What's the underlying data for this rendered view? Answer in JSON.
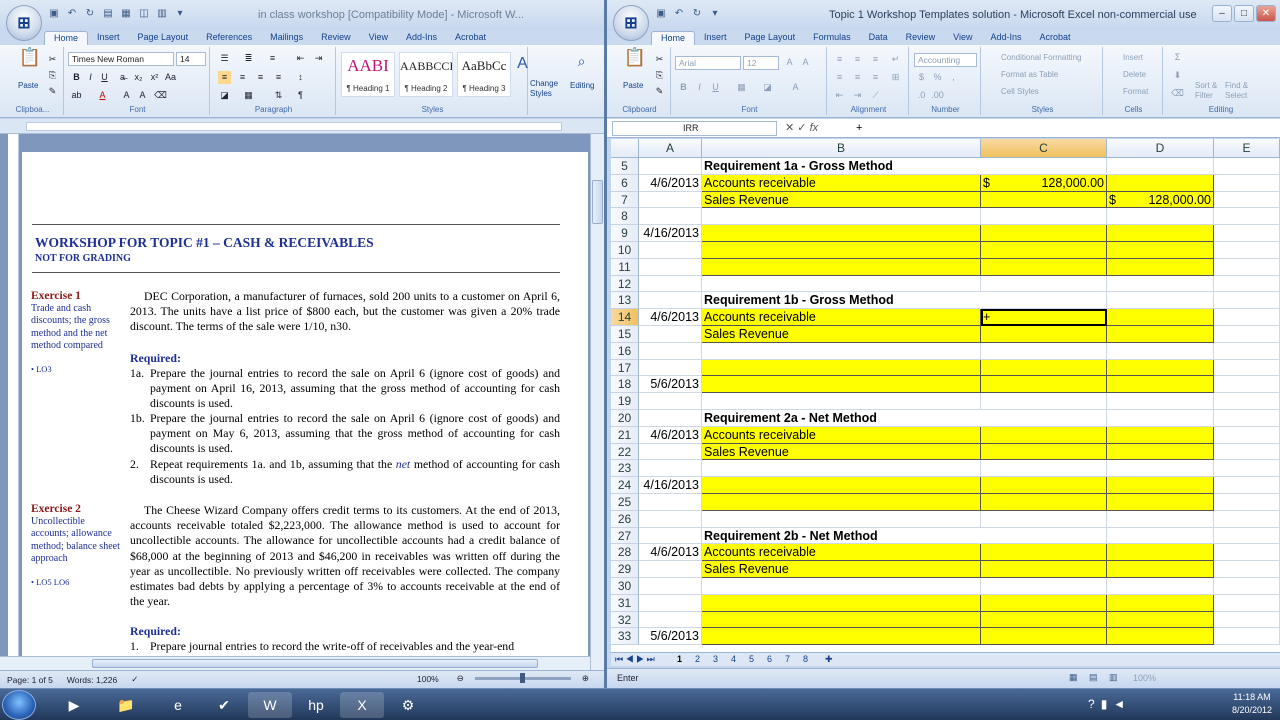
{
  "word": {
    "title": "in class workshop [Compatibility Mode] - Microsoft W...",
    "tabs": [
      "Home",
      "Insert",
      "Page Layout",
      "References",
      "Mailings",
      "Review",
      "View",
      "Add-Ins",
      "Acrobat"
    ],
    "font_name": "Times New Roman",
    "font_size": "14",
    "group_labels": {
      "clipboard": "Clipboa...",
      "font": "Font",
      "paragraph": "Paragraph",
      "styles": "Styles"
    },
    "paste_label": "Paste",
    "styles": [
      {
        "sample": "AABI",
        "name": "¶ Heading 1"
      },
      {
        "sample": "AABBCCI",
        "name": "¶ Heading 2"
      },
      {
        "sample": "AaBbCc",
        "name": "¶ Heading 3"
      }
    ],
    "change_styles": "Change Styles",
    "editing": "Editing",
    "doc": {
      "heading": "WORKSHOP FOR TOPIC #1 – CASH & RECEIVABLES",
      "subheading": "NOT FOR GRADING",
      "ex1": {
        "title": "Exercise 1",
        "desc": "Trade and cash discounts; the gross method and the net method compared",
        "lo": "• LO3",
        "para": "DEC Corporation, a manufacturer of furnaces, sold 200 units to a customer on April 6, 2013.  The units have a list price of $800 each, but the customer was given a 20% trade discount.  The terms of the sale were 1/10, n30.",
        "required": "Required:",
        "items": [
          {
            "n": "1a.",
            "t": "Prepare the journal entries to record the sale on April 6 (ignore cost of goods) and payment on April 16, 2013, assuming that the gross method of accounting for cash discounts is used."
          },
          {
            "n": "1b.",
            "t": "Prepare the journal entries to record the sale on April 6 (ignore cost of goods) and payment on May 6, 2013, assuming that the gross method of accounting for cash discounts is used."
          }
        ],
        "item2_n": "2.",
        "item2_pre": "Repeat requirements 1a. and 1b, assuming that the ",
        "item2_em": "net",
        "item2_post": " method of accounting for cash discounts is used."
      },
      "ex2": {
        "title": "Exercise 2",
        "desc": "Uncollectible accounts; allowance method; balance sheet approach",
        "lo": "• LO5 LO6",
        "para": "The Cheese Wizard Company offers credit terms to its customers.  At the end of 2013, accounts receivable totaled $2,223,000.  The allowance method is used to account for uncollectible accounts.  The allowance for uncollectible accounts had a credit balance of $68,000 at the beginning of 2013 and $46,200 in receivables was written off during the year as uncollectible.  No previously written off receivables were collected.  The company estimates bad debts by applying a percentage of 3% to accounts receivable at the end of the year.",
        "required": "Required:",
        "item1_n": "1.",
        "item1": "Prepare journal entries to record the write-off of receivables and the year-end"
      }
    },
    "status": {
      "page": "Page: 1 of 5",
      "words": "Words: 1,226",
      "zoom": "100%"
    }
  },
  "excel": {
    "title": "Topic 1 Workshop Templates solution - Microsoft Excel non-commercial use",
    "tabs": [
      "Home",
      "Insert",
      "Page Layout",
      "Formulas",
      "Data",
      "Review",
      "View",
      "Add-Ins",
      "Acrobat"
    ],
    "font_name": "Arial",
    "font_size": "12",
    "number_format": "Accounting",
    "group_labels": {
      "clipboard": "Clipboard",
      "font": "Font",
      "alignment": "Alignment",
      "number": "Number",
      "styles": "Styles",
      "cells": "Cells",
      "editing": "Editing"
    },
    "paste_label": "Paste",
    "styles_items": [
      "Conditional Formatting",
      "Format as Table",
      "Cell Styles"
    ],
    "cells_items": [
      "Insert",
      "Delete",
      "Format"
    ],
    "editing_items": [
      "Sort & Filter",
      "Find & Select"
    ],
    "name_box": "IRR",
    "formula": "+",
    "columns": [
      "A",
      "B",
      "C",
      "D",
      "E"
    ],
    "rows": [
      {
        "n": "5",
        "a": "",
        "b": "Requirement 1a - Gross Method",
        "c": "",
        "d": "",
        "y": false,
        "head": true
      },
      {
        "n": "6",
        "a": "4/6/2013",
        "b": "Accounts receivable",
        "c": "128,000.00",
        "cs": "$",
        "d": "",
        "y": true
      },
      {
        "n": "7",
        "a": "",
        "b": "Sales Revenue",
        "c": "",
        "d": "128,000.00",
        "ds": "$",
        "y": true
      },
      {
        "n": "8",
        "a": "",
        "b": "",
        "c": "",
        "d": "",
        "y": false
      },
      {
        "n": "9",
        "a": "4/16/2013",
        "b": "",
        "c": "",
        "d": "",
        "y": true
      },
      {
        "n": "10",
        "a": "",
        "b": "",
        "c": "",
        "d": "",
        "y": true
      },
      {
        "n": "11",
        "a": "",
        "b": "",
        "c": "",
        "d": "",
        "y": true
      },
      {
        "n": "12",
        "a": "",
        "b": "",
        "c": "",
        "d": "",
        "y": false
      },
      {
        "n": "13",
        "a": "",
        "b": "Requirement 1b - Gross Method",
        "c": "",
        "d": "",
        "y": false,
        "head": true
      },
      {
        "n": "14",
        "a": "4/6/2013",
        "b": "Accounts receivable",
        "c": "+",
        "d": "",
        "y": true,
        "sel": true
      },
      {
        "n": "15",
        "a": "",
        "b": "Sales Revenue",
        "c": "",
        "d": "",
        "y": true
      },
      {
        "n": "16",
        "a": "",
        "b": "",
        "c": "",
        "d": "",
        "y": false
      },
      {
        "n": "17",
        "a": "",
        "b": "",
        "c": "",
        "d": "",
        "y": true
      },
      {
        "n": "18",
        "a": "5/6/2013",
        "b": "",
        "c": "",
        "d": "",
        "y": true
      },
      {
        "n": "19",
        "a": "",
        "b": "",
        "c": "",
        "d": "",
        "y": false
      },
      {
        "n": "20",
        "a": "",
        "b": "Requirement 2a - Net Method",
        "c": "",
        "d": "",
        "y": false,
        "head": true
      },
      {
        "n": "21",
        "a": "4/6/2013",
        "b": "Accounts receivable",
        "c": "",
        "d": "",
        "y": true
      },
      {
        "n": "22",
        "a": "",
        "b": "Sales Revenue",
        "c": "",
        "d": "",
        "y": true
      },
      {
        "n": "23",
        "a": "",
        "b": "",
        "c": "",
        "d": "",
        "y": false
      },
      {
        "n": "24",
        "a": "4/16/2013",
        "b": "",
        "c": "",
        "d": "",
        "y": true
      },
      {
        "n": "25",
        "a": "",
        "b": "",
        "c": "",
        "d": "",
        "y": true
      },
      {
        "n": "26",
        "a": "",
        "b": "",
        "c": "",
        "d": "",
        "y": false
      },
      {
        "n": "27",
        "a": "",
        "b": "Requirement 2b - Net Method",
        "c": "",
        "d": "",
        "y": false,
        "head": true
      },
      {
        "n": "28",
        "a": "4/6/2013",
        "b": "Accounts receivable",
        "c": "",
        "d": "",
        "y": true
      },
      {
        "n": "29",
        "a": "",
        "b": "Sales Revenue",
        "c": "",
        "d": "",
        "y": true
      },
      {
        "n": "30",
        "a": "",
        "b": "",
        "c": "",
        "d": "",
        "y": false
      },
      {
        "n": "31",
        "a": "",
        "b": "",
        "c": "",
        "d": "",
        "y": true
      },
      {
        "n": "32",
        "a": "",
        "b": "",
        "c": "",
        "d": "",
        "y": true
      },
      {
        "n": "33",
        "a": "5/6/2013",
        "b": "",
        "c": "",
        "d": "",
        "y": true
      }
    ],
    "sheet_tabs": [
      "1",
      "2",
      "3",
      "4",
      "5",
      "6",
      "7",
      "8"
    ],
    "status_mode": "Enter",
    "zoom": "100%"
  },
  "taskbar": {
    "time": "11:18 AM",
    "date": "8/20/2012"
  }
}
